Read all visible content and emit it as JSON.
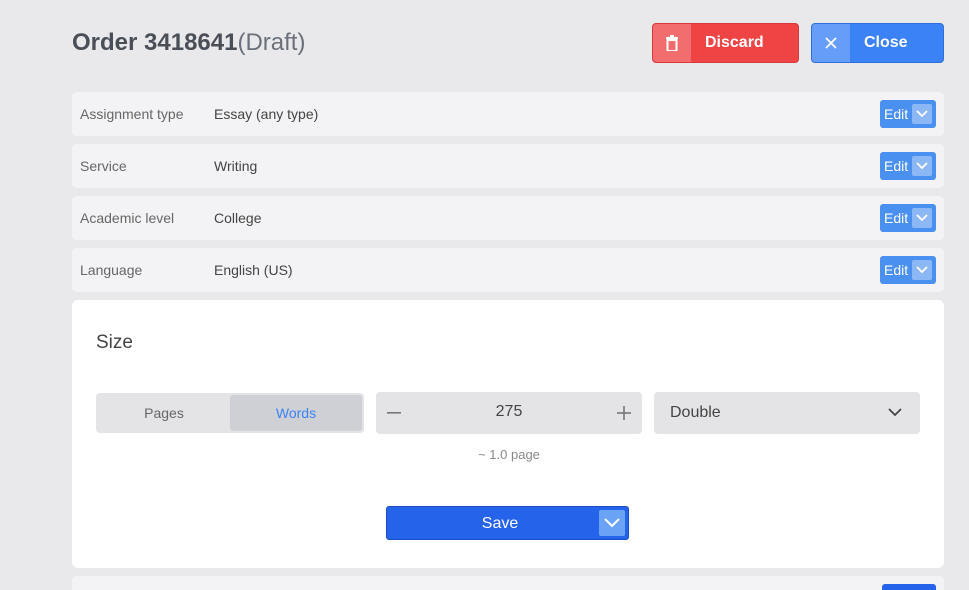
{
  "header": {
    "title_prefix": "Order 3418641",
    "title_status": "(Draft)",
    "discard_label": "Discard",
    "close_label": "Close"
  },
  "rows": [
    {
      "label": "Assignment type",
      "value": "Essay (any type)",
      "edit": "Edit"
    },
    {
      "label": "Service",
      "value": "Writing",
      "edit": "Edit"
    },
    {
      "label": "Academic level",
      "value": "College",
      "edit": "Edit"
    },
    {
      "label": "Language",
      "value": "English (US)",
      "edit": "Edit"
    }
  ],
  "size": {
    "title": "Size",
    "toggle": [
      "Pages",
      "Words"
    ],
    "selected_toggle": "Words",
    "stepper_value": "275",
    "hint": "~ 1.0 page",
    "spacing": "Double",
    "save_label": "Save"
  },
  "colors": {
    "discard": "#ef4444",
    "close": "#3b82f6",
    "save": "#2563eb",
    "edit": "#4a90f0"
  }
}
